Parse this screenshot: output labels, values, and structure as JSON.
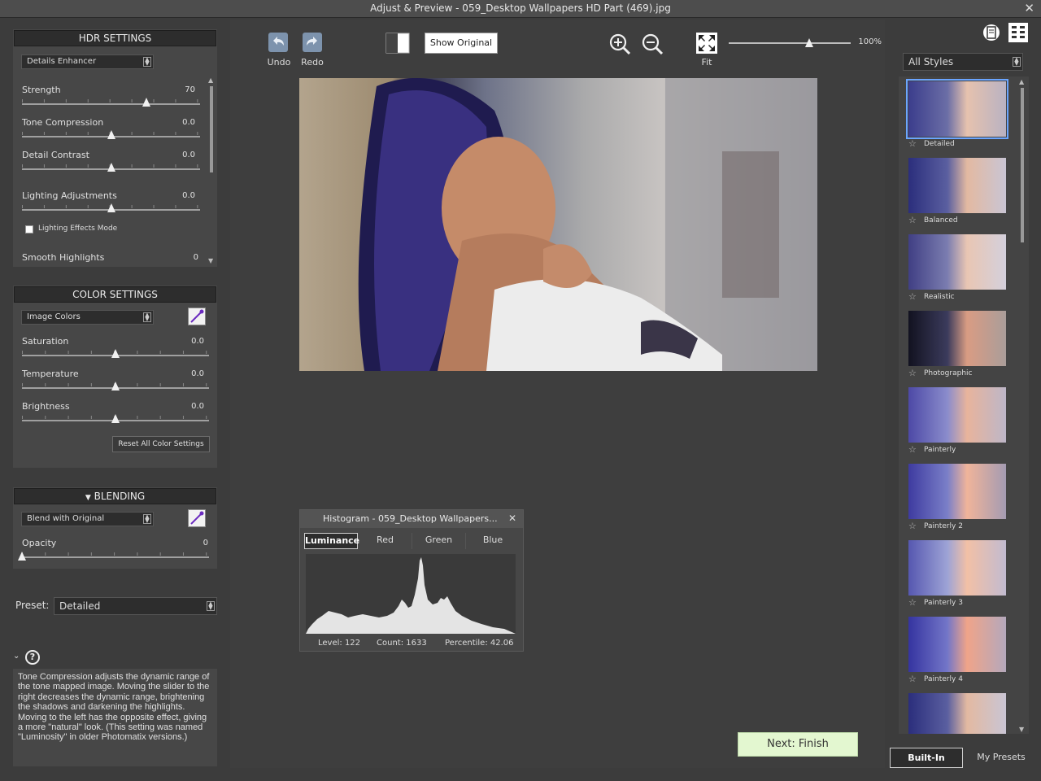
{
  "window": {
    "title": "Adjust & Preview - 059_Desktop Wallpapers  HD Part (469).jpg",
    "close_glyph": "✕"
  },
  "hdr": {
    "header": "HDR SETTINGS",
    "method": "Details Enhancer",
    "sliders": [
      {
        "label": "Strength",
        "value": "70",
        "fraction": 0.7
      },
      {
        "label": "Tone Compression",
        "value": "0.0",
        "fraction": 0.5
      },
      {
        "label": "Detail Contrast",
        "value": "0.0",
        "fraction": 0.5
      },
      {
        "label": "Lighting Adjustments",
        "value": "0.0",
        "fraction": 0.5
      }
    ],
    "lighting_effects_mode": "Lighting Effects Mode",
    "smooth_highlights": {
      "label": "Smooth Highlights",
      "value": "0"
    }
  },
  "color": {
    "header": "COLOR SETTINGS",
    "mode": "Image Colors",
    "sliders": [
      {
        "label": "Saturation",
        "value": "0.0",
        "fraction": 0.5
      },
      {
        "label": "Temperature",
        "value": "0.0",
        "fraction": 0.5
      },
      {
        "label": "Brightness",
        "value": "0.0",
        "fraction": 0.5
      }
    ],
    "reset_label": "Reset All Color Settings"
  },
  "blending": {
    "header": "BLENDING",
    "mode": "Blend with Original",
    "opacity_label": "Opacity",
    "opacity_value": "0",
    "opacity_fraction": 0.0
  },
  "preset": {
    "label": "Preset:",
    "value": "Detailed"
  },
  "help": {
    "text": "Tone Compression adjusts the dynamic range of the tone mapped image. Moving the slider to the right decreases the dynamic range, brightening the shadows and darkening the highlights. Moving to the left has the opposite effect, giving a more \"natural\" look. (This setting was named \"Luminosity\" in older Photomatix versions.)"
  },
  "toolbar": {
    "undo": "Undo",
    "redo": "Redo",
    "show_original": "Show Original",
    "fit": "Fit",
    "zoom_value": "100%",
    "zoom_fraction": 0.5
  },
  "histogram": {
    "title": "Histogram - 059_Desktop Wallpapers...",
    "tabs": [
      "Luminance",
      "Red",
      "Green",
      "Blue"
    ],
    "level": "Level: 122",
    "count": "Count: 1633",
    "percentile": "Percentile: 42.06"
  },
  "next_button": "Next: Finish",
  "styles": {
    "filter": "All Styles",
    "items": [
      {
        "label": "Detailed"
      },
      {
        "label": "Balanced"
      },
      {
        "label": "Realistic"
      },
      {
        "label": "Photographic"
      },
      {
        "label": "Painterly"
      },
      {
        "label": "Painterly 2"
      },
      {
        "label": "Painterly 3"
      },
      {
        "label": "Painterly 4"
      }
    ],
    "tab_builtin": "Built-In",
    "tab_mypresets": "My Presets"
  },
  "colors": {
    "accent": "#6aa5ff",
    "next_button_bg": "#e3f7d0",
    "panel_bg": "#474747"
  }
}
